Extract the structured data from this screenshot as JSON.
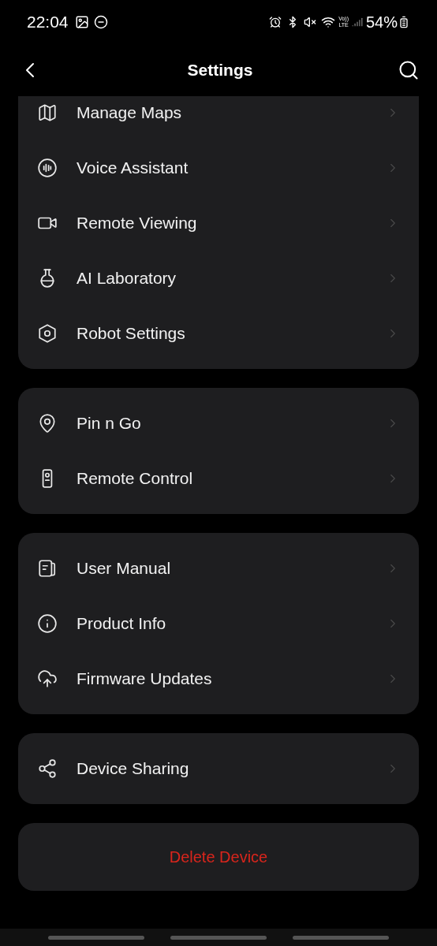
{
  "status_bar": {
    "time": "22:04",
    "network": "Vo))\nLTE",
    "battery": "54%"
  },
  "header": {
    "title": "Settings"
  },
  "groups": [
    {
      "items": [
        {
          "label": "Manage Maps"
        },
        {
          "label": "Voice Assistant"
        },
        {
          "label": "Remote Viewing"
        },
        {
          "label": "AI Laboratory"
        },
        {
          "label": "Robot Settings"
        }
      ]
    },
    {
      "items": [
        {
          "label": "Pin n Go"
        },
        {
          "label": "Remote Control"
        }
      ]
    },
    {
      "items": [
        {
          "label": "User Manual"
        },
        {
          "label": "Product Info"
        },
        {
          "label": "Firmware Updates"
        }
      ]
    },
    {
      "items": [
        {
          "label": "Device Sharing"
        }
      ]
    }
  ],
  "delete_button": {
    "label": "Delete Device"
  }
}
